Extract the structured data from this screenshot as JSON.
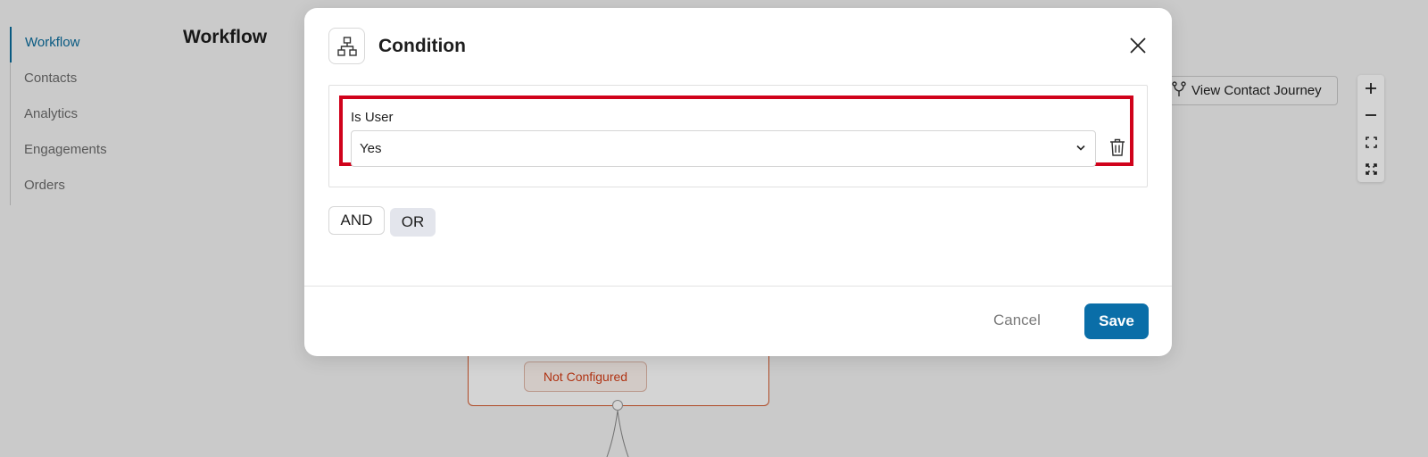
{
  "sidebar": {
    "items": [
      {
        "label": "Workflow",
        "active": true
      },
      {
        "label": "Contacts",
        "active": false
      },
      {
        "label": "Analytics",
        "active": false
      },
      {
        "label": "Engagements",
        "active": false
      },
      {
        "label": "Orders",
        "active": false
      }
    ]
  },
  "page": {
    "title": "Workflow"
  },
  "toolbar": {
    "journey_label": "View Contact Journey"
  },
  "canvas": {
    "node_status": "Not Configured"
  },
  "modal": {
    "title": "Condition",
    "condition": {
      "label": "Is User",
      "selected_value": "Yes"
    },
    "logic": {
      "and_label": "AND",
      "or_label": "OR",
      "active": "OR"
    },
    "cancel_label": "Cancel",
    "save_label": "Save"
  },
  "colors": {
    "accent": "#0a6ea8",
    "highlight": "#d0021b",
    "node_border": "#d35a2e",
    "status_text": "#d43e17"
  }
}
